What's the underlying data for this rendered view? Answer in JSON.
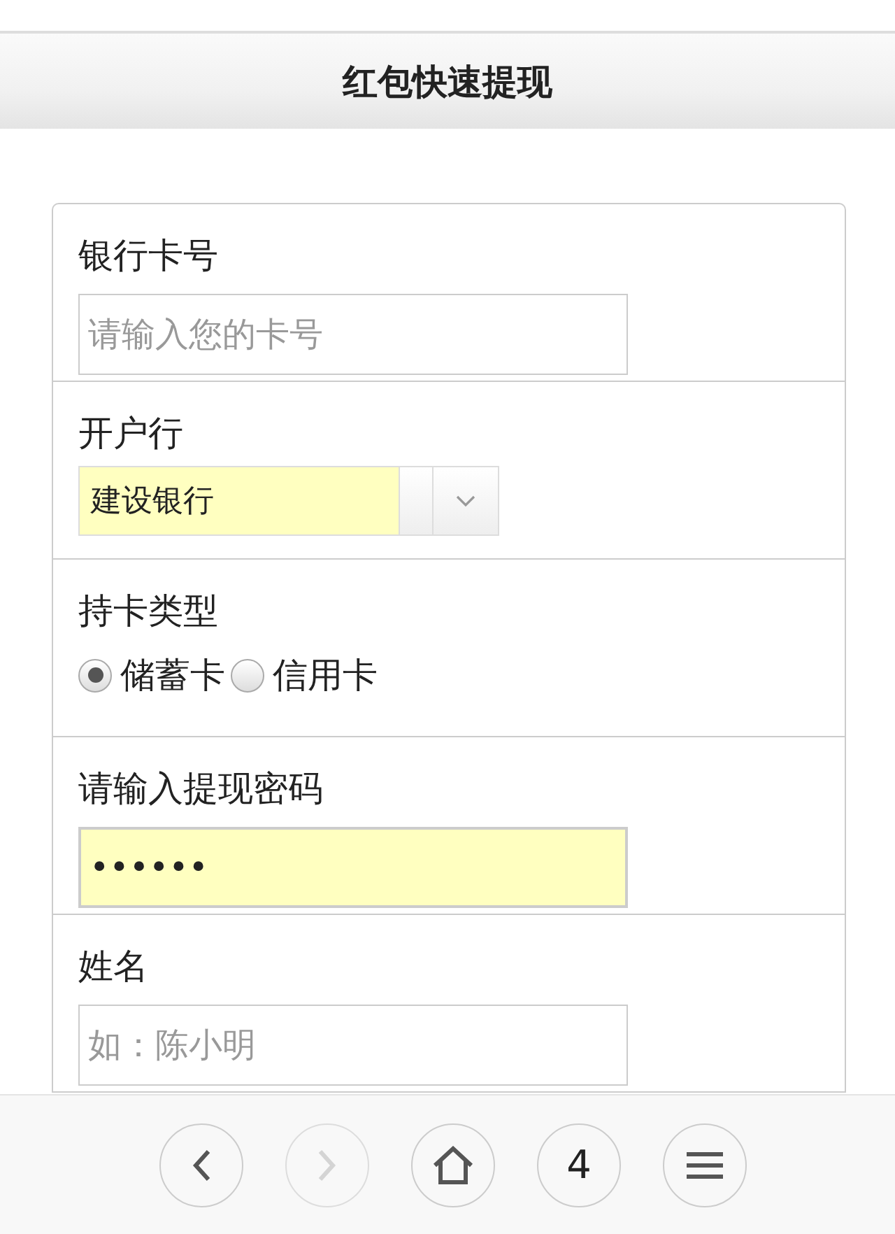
{
  "header": {
    "title": "红包快速提现"
  },
  "form": [
    {
      "kind": "text",
      "label": "银行卡号",
      "placeholder": "请输入您的卡号"
    },
    {
      "kind": "select",
      "label": "开户行",
      "value": "建设银行",
      "autofilled": true
    },
    {
      "kind": "radio",
      "label": "持卡类型",
      "options": [
        {
          "label": "储蓄卡",
          "selected": true
        },
        {
          "label": "信用卡",
          "selected": false
        }
      ]
    },
    {
      "kind": "password",
      "label": "请输入提现密码",
      "value": "••••••",
      "autofilled": true
    },
    {
      "kind": "text",
      "label": "姓名",
      "placeholder": "如：陈小明"
    }
  ],
  "toolbar": [
    {
      "kind": "back",
      "disabled": false
    },
    {
      "kind": "forward",
      "disabled": true
    },
    {
      "kind": "home",
      "disabled": false
    },
    {
      "kind": "tabs",
      "count": "4",
      "disabled": false
    },
    {
      "kind": "menu",
      "disabled": false
    }
  ]
}
